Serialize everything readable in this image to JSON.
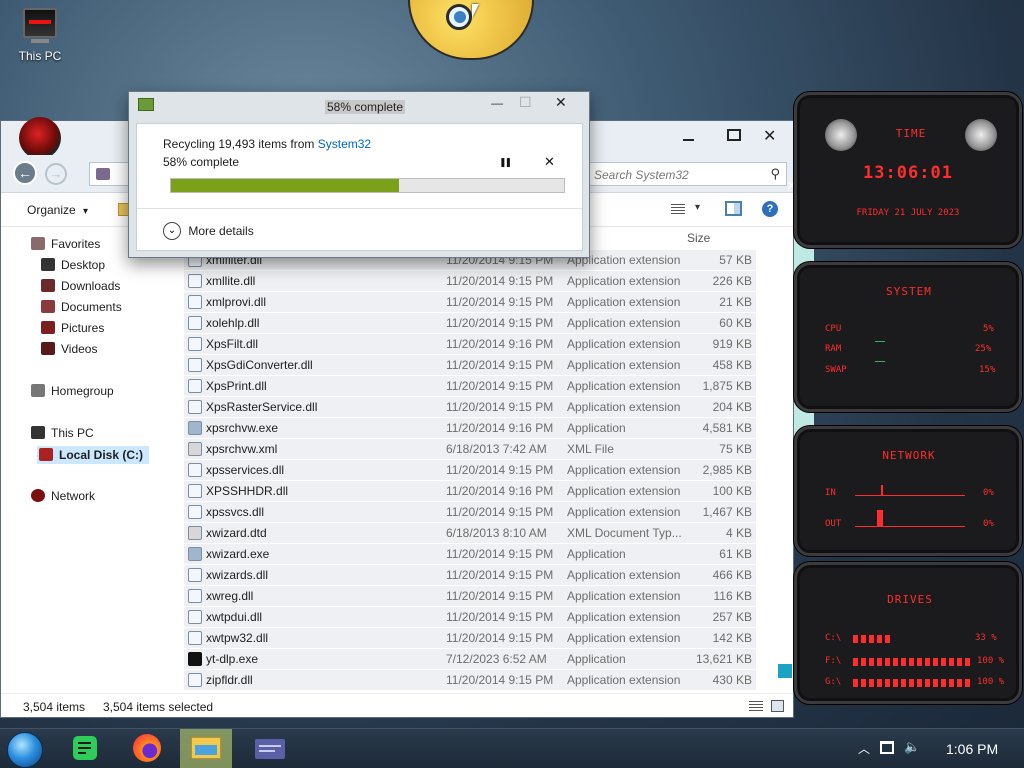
{
  "desktop": {
    "icons": [
      {
        "label": "This PC",
        "icon": "monitor-icon"
      }
    ]
  },
  "explorer": {
    "address": {
      "partial_text": "T"
    },
    "search_placeholder": "Search System32",
    "toolbar": {
      "organize": "Organize",
      "organize_chevron": "▾",
      "view_chevron": "▾",
      "help": "?"
    },
    "nav": {
      "favorites": "Favorites",
      "desktop": "Desktop",
      "downloads": "Downloads",
      "documents": "Documents",
      "pictures": "Pictures",
      "videos": "Videos",
      "homegroup": "Homegroup",
      "thispc": "This PC",
      "localdisk": "Local Disk (C:)",
      "network": "Network"
    },
    "columns": {
      "size": "Size"
    },
    "files": [
      {
        "name": "xmlfilter.dll",
        "date": "11/20/2014 9:15 PM",
        "type": "Application extension",
        "size": "57 KB"
      },
      {
        "name": "xmllite.dll",
        "date": "11/20/2014 9:15 PM",
        "type": "Application extension",
        "size": "226 KB"
      },
      {
        "name": "xmlprovi.dll",
        "date": "11/20/2014 9:15 PM",
        "type": "Application extension",
        "size": "21 KB"
      },
      {
        "name": "xolehlp.dll",
        "date": "11/20/2014 9:15 PM",
        "type": "Application extension",
        "size": "60 KB"
      },
      {
        "name": "XpsFilt.dll",
        "date": "11/20/2014 9:16 PM",
        "type": "Application extension",
        "size": "919 KB"
      },
      {
        "name": "XpsGdiConverter.dll",
        "date": "11/20/2014 9:15 PM",
        "type": "Application extension",
        "size": "458 KB"
      },
      {
        "name": "XpsPrint.dll",
        "date": "11/20/2014 9:15 PM",
        "type": "Application extension",
        "size": "1,875 KB"
      },
      {
        "name": "XpsRasterService.dll",
        "date": "11/20/2014 9:15 PM",
        "type": "Application extension",
        "size": "204 KB"
      },
      {
        "name": "xpsrchvw.exe",
        "date": "11/20/2014 9:16 PM",
        "type": "Application",
        "size": "4,581 KB"
      },
      {
        "name": "xpsrchvw.xml",
        "date": "6/18/2013 7:42 AM",
        "type": "XML File",
        "size": "75 KB"
      },
      {
        "name": "xpsservices.dll",
        "date": "11/20/2014 9:15 PM",
        "type": "Application extension",
        "size": "2,985 KB"
      },
      {
        "name": "XPSSHHDR.dll",
        "date": "11/20/2014 9:16 PM",
        "type": "Application extension",
        "size": "100 KB"
      },
      {
        "name": "xpssvcs.dll",
        "date": "11/20/2014 9:15 PM",
        "type": "Application extension",
        "size": "1,467 KB"
      },
      {
        "name": "xwizard.dtd",
        "date": "6/18/2013 8:10 AM",
        "type": "XML Document Typ...",
        "size": "4 KB"
      },
      {
        "name": "xwizard.exe",
        "date": "11/20/2014 9:15 PM",
        "type": "Application",
        "size": "61 KB"
      },
      {
        "name": "xwizards.dll",
        "date": "11/20/2014 9:15 PM",
        "type": "Application extension",
        "size": "466 KB"
      },
      {
        "name": "xwreg.dll",
        "date": "11/20/2014 9:15 PM",
        "type": "Application extension",
        "size": "116 KB"
      },
      {
        "name": "xwtpdui.dll",
        "date": "11/20/2014 9:15 PM",
        "type": "Application extension",
        "size": "257 KB"
      },
      {
        "name": "xwtpw32.dll",
        "date": "11/20/2014 9:15 PM",
        "type": "Application extension",
        "size": "142 KB"
      },
      {
        "name": "yt-dlp.exe",
        "date": "7/12/2023 6:52 AM",
        "type": "Application",
        "size": "13,621 KB"
      },
      {
        "name": "zipfldr.dll",
        "date": "11/20/2014 9:15 PM",
        "type": "Application extension",
        "size": "430 KB"
      }
    ],
    "status": {
      "items": "3,504 items",
      "selected": "3,504 items selected"
    }
  },
  "dialog": {
    "title": "58% complete",
    "line1_prefix": "Recycling 19,493 items from ",
    "line1_link": "System32",
    "line2": "58% complete",
    "progress": 0.58,
    "more_details": "More details",
    "pause": "❚❚",
    "cancel": "✕",
    "minimize": "—",
    "maximize": "☐",
    "close": "✕"
  },
  "gadget": {
    "time_title": "TIME",
    "time": "13:06:01",
    "date": "FRIDAY 21 JULY 2023",
    "system_title": "SYSTEM",
    "cpu_label": "CPU",
    "cpu_value": "5%",
    "ram_label": "RAM",
    "ram_value": "25%",
    "swap_label": "SWAP",
    "swap_value": "15%",
    "network_title": "NETWORK",
    "in_label": "IN",
    "in_value": "0%",
    "out_label": "OUT",
    "out_value": "0%",
    "drives_title": "DRIVES",
    "drives": [
      {
        "label": "C:\\",
        "value": "33 %"
      },
      {
        "label": "F:\\",
        "value": "100 %"
      },
      {
        "label": "G:\\",
        "value": "100 %"
      }
    ]
  },
  "taskbar": {
    "time": "1:06 PM"
  },
  "colors": {
    "accent": "#7ba11a",
    "link": "#0066cc",
    "gadget_red": "#ff2d2d"
  }
}
